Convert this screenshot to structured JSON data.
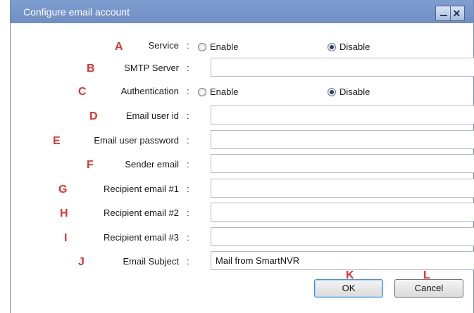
{
  "window": {
    "title": "Configure email account"
  },
  "letters": [
    "A",
    "B",
    "C",
    "D",
    "E",
    "F",
    "G",
    "H",
    "I",
    "J",
    "K",
    "L"
  ],
  "fields": {
    "service": {
      "label": "Service",
      "enable": "Enable",
      "disable": "Disable",
      "selected": "Disable"
    },
    "smtp": {
      "label": "SMTP Server",
      "value": ""
    },
    "auth": {
      "label": "Authentication",
      "enable": "Enable",
      "disable": "Disable",
      "selected": "Disable"
    },
    "user_id": {
      "label": "Email user id",
      "value": ""
    },
    "user_password": {
      "label": "Email user password",
      "value": ""
    },
    "sender": {
      "label": "Sender email",
      "value": ""
    },
    "recipient1": {
      "label": "Recipient email #1",
      "value": ""
    },
    "recipient2": {
      "label": "Recipient email #2",
      "value": ""
    },
    "recipient3": {
      "label": "Recipient email #3",
      "value": ""
    },
    "subject": {
      "label": "Email Subject",
      "value": "Mail from SmartNVR"
    }
  },
  "colon": ":",
  "buttons": {
    "ok": "OK",
    "cancel": "Cancel"
  },
  "colors": {
    "titlebar": "#7e9ed0",
    "marker": "#e0322e",
    "ok_focus": "#3b8cd8"
  }
}
